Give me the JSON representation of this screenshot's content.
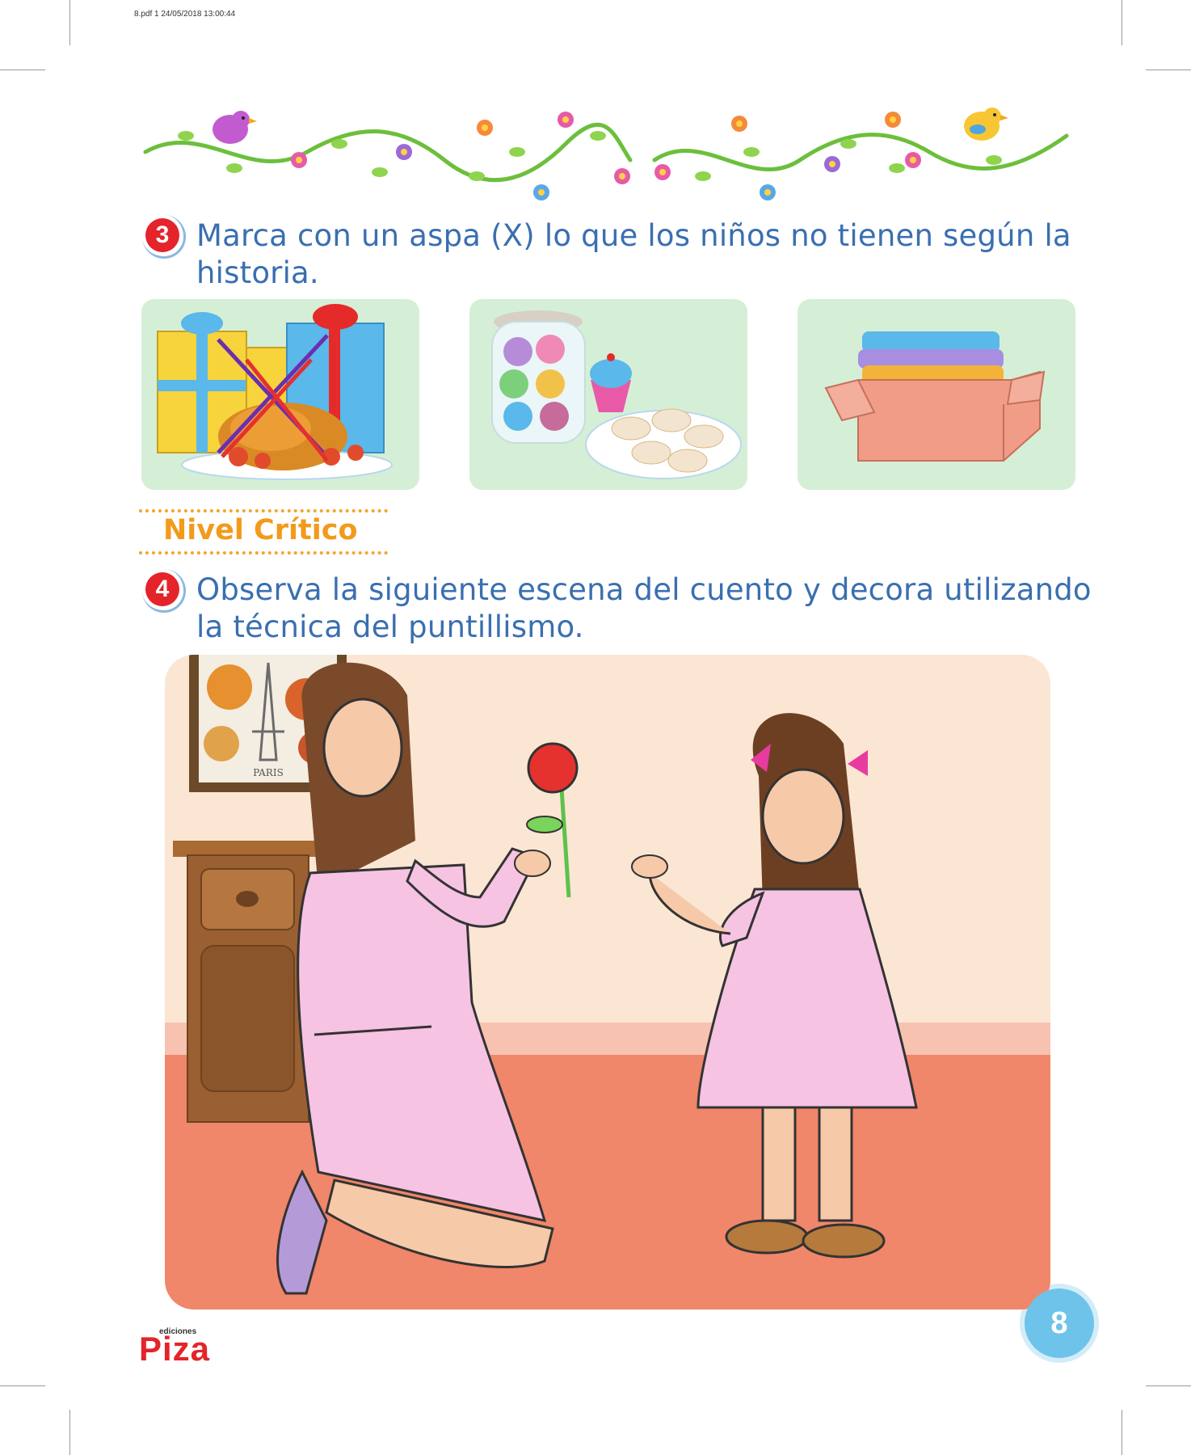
{
  "print_header": "8.pdf   1   24/05/2018   13:00:44",
  "exercise3": {
    "number": "3",
    "line1": "Marca con un aspa (X) lo que los niños no tienen según la",
    "line2": "historia."
  },
  "section_title": "Nivel Crítico",
  "exercise4": {
    "number": "4",
    "line1": "Observa la siguiente escena del cuento y decora utilizando",
    "line2": "la técnica del puntillismo."
  },
  "scene": {
    "poster_text": "PARIS"
  },
  "page_number": "8",
  "brand": {
    "small": "ediciones",
    "name": "Piza"
  },
  "colors": {
    "instruction_blue": "#3a6fb0",
    "badge_red": "#e4242a",
    "section_orange": "#f39a1b",
    "panel_green": "#d5efd6",
    "page_badge_blue": "#6ec3ea"
  }
}
